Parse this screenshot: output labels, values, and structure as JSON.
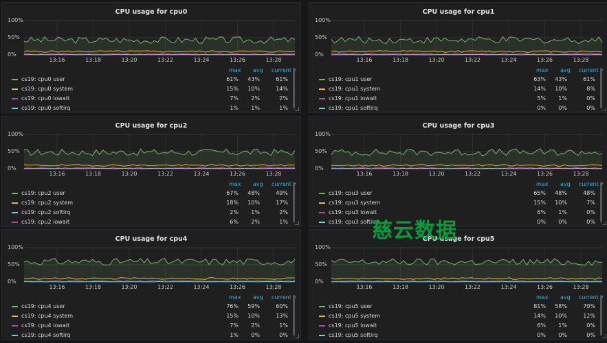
{
  "legend_headers": {
    "max": "max",
    "avg": "avg",
    "current": "current ▾"
  },
  "y_ticks": [
    "100%",
    "50%",
    "0%"
  ],
  "x_ticks": [
    "13:16",
    "13:18",
    "13:20",
    "13:22",
    "13:24",
    "13:26",
    "13:28"
  ],
  "watermark": "慈云数据",
  "colors": {
    "user": "#7eb26d",
    "system": "#eab839",
    "iowait": "#ba43a9",
    "softirq": "#6ed0e0"
  },
  "panels": [
    {
      "title": "CPU usage for cpu0",
      "rows": [
        {
          "name": "cs19: cpu0 user",
          "color_key": "user",
          "max": "61%",
          "avg": "43%",
          "current": "61%"
        },
        {
          "name": "cs19: cpu0 system",
          "color_key": "system",
          "max": "15%",
          "avg": "10%",
          "current": "14%"
        },
        {
          "name": "cs19: cpu0 iowait",
          "color_key": "iowait",
          "max": "7%",
          "avg": "2%",
          "current": "2%"
        },
        {
          "name": "cs19: cpu0 softirq",
          "color_key": "softirq",
          "max": "1%",
          "avg": "1%",
          "current": "1%"
        }
      ]
    },
    {
      "title": "CPU usage for cpu1",
      "rows": [
        {
          "name": "cs19: cpu1 user",
          "color_key": "user",
          "max": "63%",
          "avg": "43%",
          "current": "61%"
        },
        {
          "name": "cs19: cpu1 system",
          "color_key": "system",
          "max": "14%",
          "avg": "10%",
          "current": "8%"
        },
        {
          "name": "cs19: cpu1 iowait",
          "color_key": "iowait",
          "max": "5%",
          "avg": "1%",
          "current": "0%"
        },
        {
          "name": "cs19: cpu1 softirq",
          "color_key": "softirq",
          "max": "0%",
          "avg": "0%",
          "current": "0%"
        }
      ]
    },
    {
      "title": "CPU usage for cpu2",
      "rows": [
        {
          "name": "cs19: cpu2 user",
          "color_key": "user",
          "max": "67%",
          "avg": "48%",
          "current": "49%"
        },
        {
          "name": "cs19: cpu2 system",
          "color_key": "system",
          "max": "18%",
          "avg": "10%",
          "current": "17%"
        },
        {
          "name": "cs19: cpu2 softirq",
          "color_key": "softirq",
          "max": "2%",
          "avg": "1%",
          "current": "2%"
        },
        {
          "name": "cs19: cpu2 iowait",
          "color_key": "iowait",
          "max": "6%",
          "avg": "2%",
          "current": "1%"
        }
      ]
    },
    {
      "title": "CPU usage for cpu3",
      "rows": [
        {
          "name": "cs19: cpu3 user",
          "color_key": "user",
          "max": "65%",
          "avg": "48%",
          "current": "48%"
        },
        {
          "name": "cs19: cpu3 system",
          "color_key": "system",
          "max": "15%",
          "avg": "10%",
          "current": "7%"
        },
        {
          "name": "cs19: cpu3 iowait",
          "color_key": "iowait",
          "max": "6%",
          "avg": "1%",
          "current": "0%"
        },
        {
          "name": "cs19: cpu3 softirq",
          "color_key": "softirq",
          "max": "0%",
          "avg": "0%",
          "current": "0%"
        }
      ]
    },
    {
      "title": "CPU usage for cpu4",
      "rows": [
        {
          "name": "cs19: cpu4 user",
          "color_key": "user",
          "max": "76%",
          "avg": "59%",
          "current": "60%"
        },
        {
          "name": "cs19: cpu4 system",
          "color_key": "system",
          "max": "15%",
          "avg": "10%",
          "current": "13%"
        },
        {
          "name": "cs19: cpu4 iowait",
          "color_key": "iowait",
          "max": "7%",
          "avg": "2%",
          "current": "1%"
        },
        {
          "name": "cs19: cpu4 softirq",
          "color_key": "softirq",
          "max": "1%",
          "avg": "0%",
          "current": "0%"
        }
      ]
    },
    {
      "title": "CPU usage for cpu5",
      "rows": [
        {
          "name": "cs19: cpu5 user",
          "color_key": "user",
          "max": "81%",
          "avg": "58%",
          "current": "70%"
        },
        {
          "name": "cs19: cpu5 system",
          "color_key": "system",
          "max": "14%",
          "avg": "10%",
          "current": "12%"
        },
        {
          "name": "cs19: cpu5 iowait",
          "color_key": "iowait",
          "max": "6%",
          "avg": "1%",
          "current": "0%"
        },
        {
          "name": "cs19: cpu5 softirq",
          "color_key": "softirq",
          "max": "0%",
          "avg": "0%",
          "current": "0%"
        }
      ]
    }
  ]
}
